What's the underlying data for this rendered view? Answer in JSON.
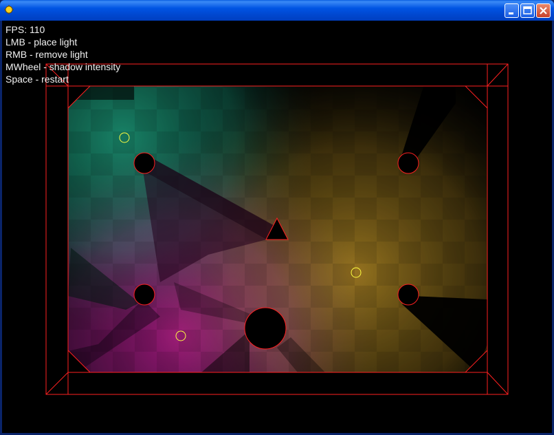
{
  "window": {
    "title": "",
    "accent": "#0054e3",
    "controls": {
      "minimize": "minimize-icon",
      "maximize": "maximize-icon",
      "close": "close-icon"
    }
  },
  "hud": {
    "fps": "FPS: 110",
    "lines": [
      "LMB - place light",
      "RMB - remove light",
      "MWheel - shadow intensity",
      "Space - restart"
    ]
  },
  "scene": {
    "outline_color": "#ff2020",
    "light_marker_color": "#ffff40",
    "light_colors": {
      "teal": "#1fb08a",
      "magenta": "#d01fa0",
      "amber": "#c89a28"
    }
  }
}
